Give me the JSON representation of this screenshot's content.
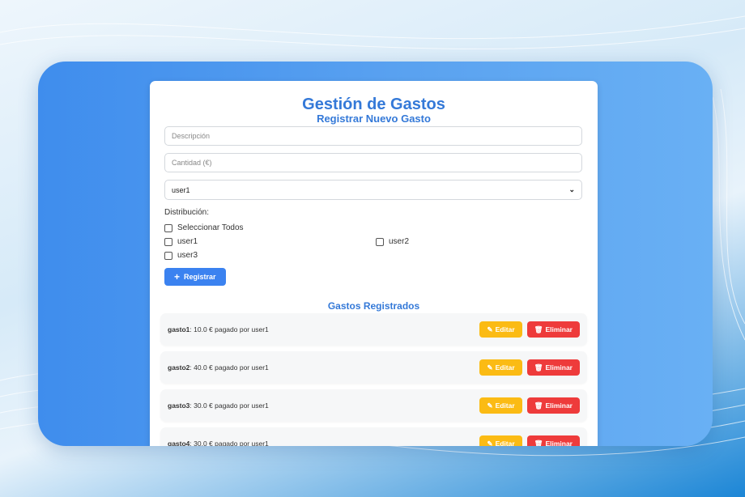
{
  "app": {
    "title": "Gestión de Gastos",
    "form_title": "Registrar Nuevo Gasto"
  },
  "form": {
    "description_placeholder": "Descripción",
    "amount_placeholder": "Cantidad (€)",
    "payer_selected": "user1",
    "distribution_label": "Distribución:",
    "select_all_label": "Seleccionar Todos",
    "users": [
      "user1",
      "user2",
      "user3"
    ],
    "register_label": "Registrar"
  },
  "list": {
    "title": "Gastos Registrados",
    "edit_label": "Editar",
    "delete_label": "Eliminar",
    "items": [
      {
        "name": "gasto1",
        "detail": ": 10.0 € pagado por user1"
      },
      {
        "name": "gasto2",
        "detail": ": 40.0 € pagado por user1"
      },
      {
        "name": "gasto3",
        "detail": ": 30.0 € pagado por user1"
      },
      {
        "name": "gasto4",
        "detail": ": 30.0 € pagado por user1"
      }
    ]
  },
  "colors": {
    "accent": "#3479d8",
    "primary_button": "#3b82f0",
    "edit_button": "#fbbb14",
    "delete_button": "#ee3b3b"
  }
}
